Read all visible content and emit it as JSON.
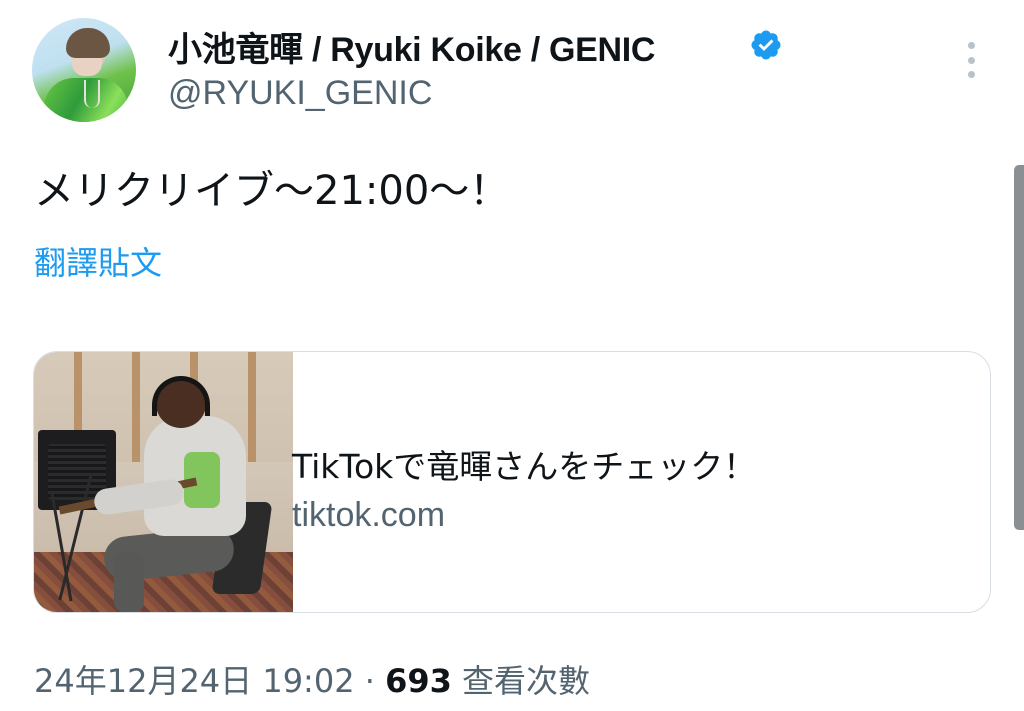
{
  "author": {
    "display_name": "小池竜暉 / Ryuki Koike / GENIC",
    "handle": "@RYUKI_GENIC",
    "verified_badge_icon": "verified-badge-icon",
    "verified_color": "#1d9bf0"
  },
  "tweet": {
    "text": "メリクリイブ〜21:00〜！",
    "translate_label": "翻譯貼文"
  },
  "link_card": {
    "title": "TikTokで竜暉さんをチェック！",
    "domain": "tiktok.com",
    "thumbnail_icon": "studio-guitar-photo"
  },
  "meta": {
    "timestamp": "24年12月24日 19:02",
    "separator": "·",
    "views_count": "693",
    "views_label": "查看次數"
  },
  "colors": {
    "text_primary": "#0f1419",
    "text_secondary": "#536471",
    "accent": "#1d9bf0",
    "border": "#d8dee3"
  }
}
